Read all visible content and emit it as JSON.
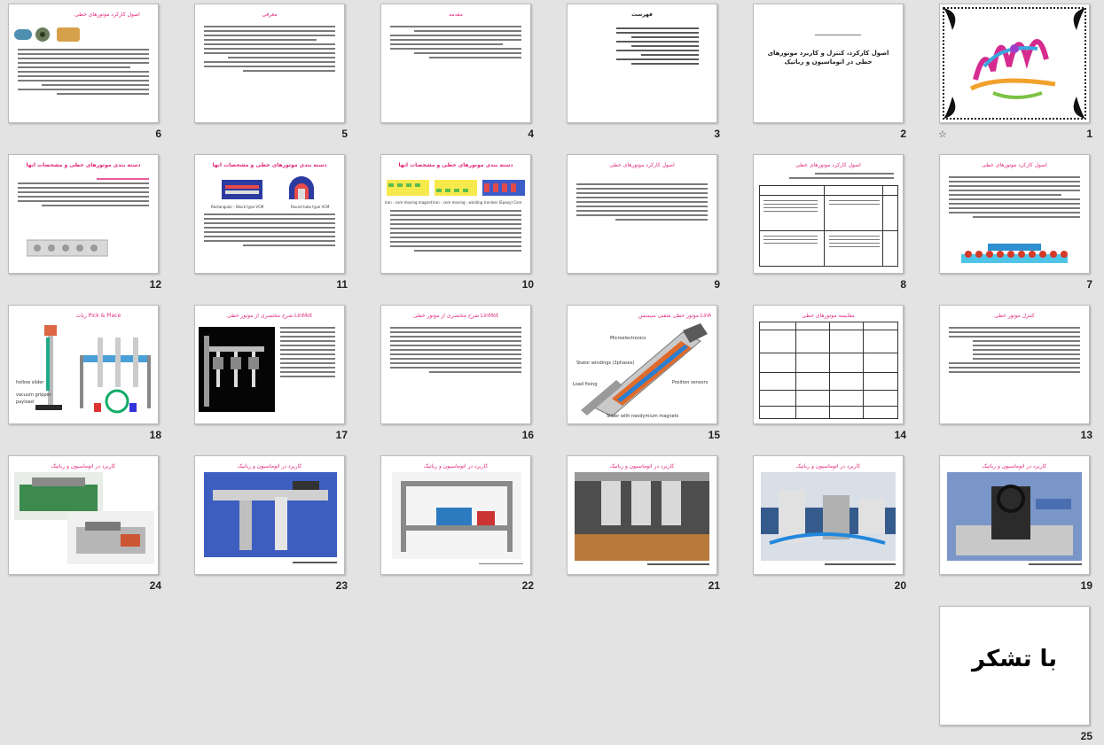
{
  "app": {
    "view": "slide-sorter"
  },
  "slides": [
    {
      "number": "1",
      "title": ""
    },
    {
      "number": "2",
      "title": "اصول کارکرد، کنترل و کاربرد موتورهای خطی در اتوماسیون و رباتیک"
    },
    {
      "number": "3",
      "title": "فهرست"
    },
    {
      "number": "4",
      "title": "مقدمه"
    },
    {
      "number": "5",
      "title": "معرفی"
    },
    {
      "number": "6",
      "title": "اصول کارکرد موتورهای خطی"
    },
    {
      "number": "7",
      "title": "اصول کارکرد موتورهای خطی"
    },
    {
      "number": "8",
      "title": "اصول کارکرد موتورهای خطی"
    },
    {
      "number": "9",
      "title": "اصول کارکرد موتورهای خطی"
    },
    {
      "number": "10",
      "title": "دسته بندی موتورهای خطی و مشخصات آنها"
    },
    {
      "number": "11",
      "title": "دسته بندی موتورهای خطی و مشخصات آنها"
    },
    {
      "number": "12",
      "title": "دسته بندی موتورهای خطی و مشخصات آنها"
    },
    {
      "number": "13",
      "title": "کنترل موتور خطی"
    },
    {
      "number": "14",
      "title": "مقایسه موتورهای خطی"
    },
    {
      "number": "15",
      "title": "موتور خطی شفتی سیمنس LinMot"
    },
    {
      "number": "16",
      "title": "شرح مختصری از موتور خطی LinMot"
    },
    {
      "number": "17",
      "title": "شرح مختصری از موتور خطی LinMot"
    },
    {
      "number": "18",
      "title": "ربات Pick & Place"
    },
    {
      "number": "19",
      "title": "کاربرد در اتوماسیون و رباتیک"
    },
    {
      "number": "20",
      "title": "کاربرد در اتوماسیون و رباتیک"
    },
    {
      "number": "21",
      "title": "کاربرد در اتوماسیون و رباتیک"
    },
    {
      "number": "22",
      "title": "کاربرد در اتوماسیون و رباتیک"
    },
    {
      "number": "23",
      "title": "کاربرد در اتوماسیون و رباتیک"
    },
    {
      "number": "24",
      "title": "کاربرد در اتوماسیون و رباتیک"
    },
    {
      "number": "25",
      "title": "با تشکر"
    }
  ],
  "slide15_labels": {
    "microelectronics": "Microelectronics",
    "stator": "Stator windings (3phases)",
    "position": "Position sensors",
    "load": "Load fixing",
    "slider": "Slider with neodymium magnets"
  },
  "slide18_labels": {
    "hollow": "hollow slider",
    "vacuum": "vacuum gripper",
    "payload": "payload"
  },
  "slide11_labels": {
    "rect": "Rectangular - Block type VCM",
    "round": "Round tube type VCM"
  },
  "slide10_labels": {
    "a": "Iron - core moving magnet",
    "b": "Iron - core moving - winding",
    "c": "Ironless (Epoxy) Core"
  },
  "colors": {
    "title_pink": "#e0267a",
    "background": "#e3e3e3"
  }
}
